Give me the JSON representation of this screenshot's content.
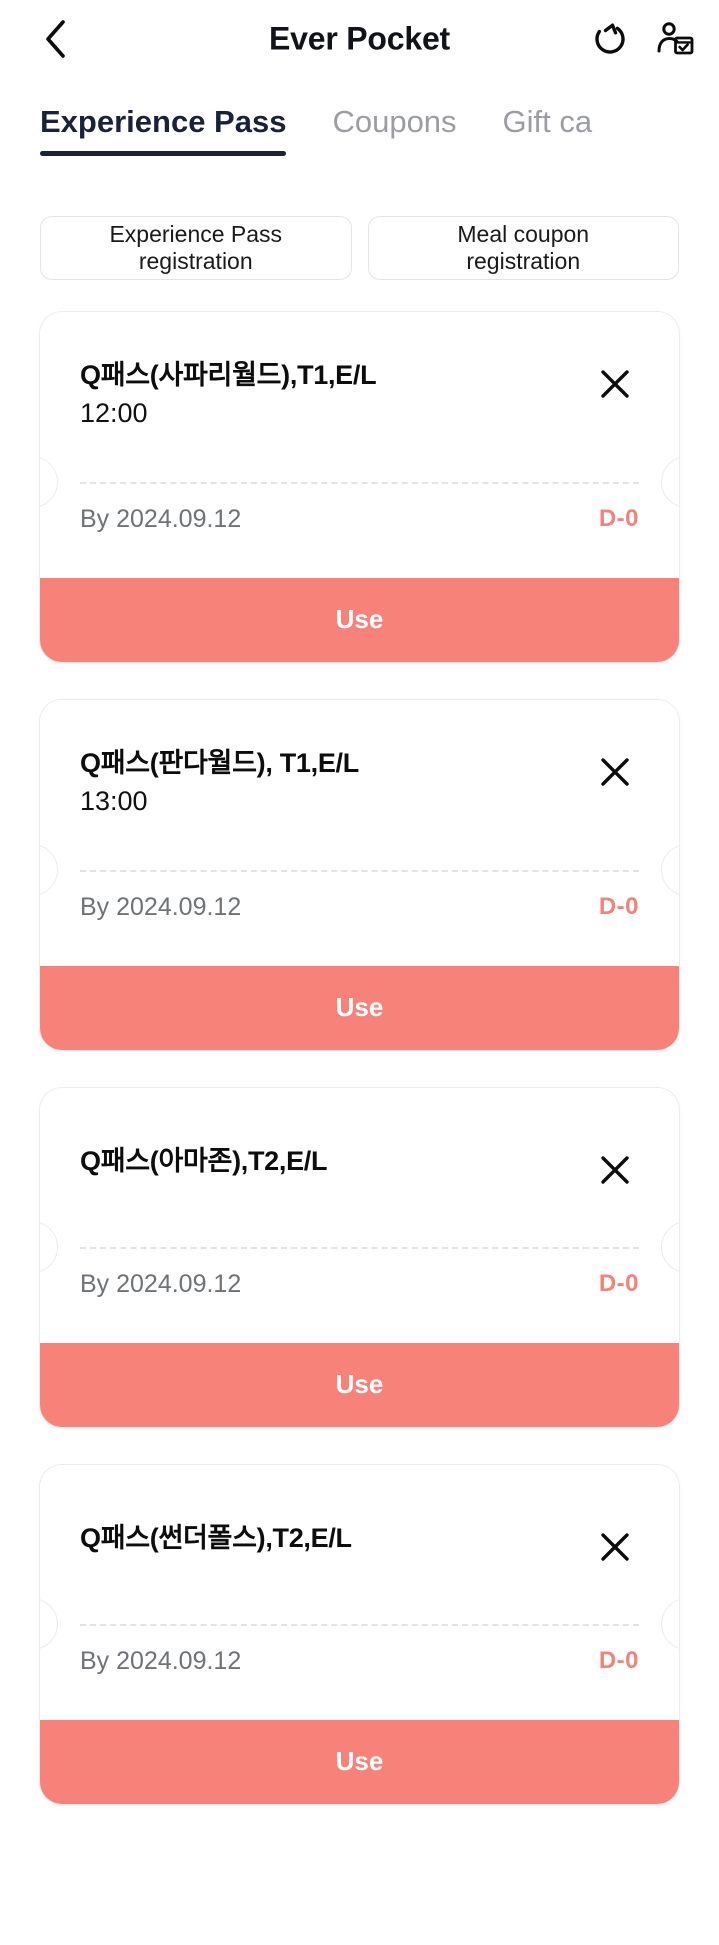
{
  "header": {
    "title": "Ever Pocket",
    "back_icon": "chevron-left-icon",
    "refresh_icon": "refresh-icon",
    "profile_icon": "person-calendar-check-icon"
  },
  "tabs": [
    {
      "label": "Experience Pass",
      "active": true
    },
    {
      "label": "Coupons",
      "active": false
    },
    {
      "label": "Gift ca",
      "active": false
    }
  ],
  "registration": {
    "experience_pass_label": "Experience Pass\nregistration",
    "experience_pass_line1": "Experience Pass",
    "experience_pass_line2": "registration",
    "meal_coupon_line1": "Meal coupon",
    "meal_coupon_line2": "registration"
  },
  "colors": {
    "accent": "#f68279",
    "dday": "#f0847c",
    "tab_active": "#1b2238",
    "tab_inactive": "#9b9da3"
  },
  "tickets": [
    {
      "title": "Q패스(사파리월드),T1,E/L",
      "time": "12:00",
      "date": "By 2024.09.12",
      "dday": "D-0",
      "use_label": "Use",
      "close_icon": "close-icon"
    },
    {
      "title": "Q패스(판다월드), T1,E/L",
      "time": "13:00",
      "date": "By 2024.09.12",
      "dday": "D-0",
      "use_label": "Use",
      "close_icon": "close-icon"
    },
    {
      "title": "Q패스(아마존),T2,E/L",
      "time": "",
      "date": "By 2024.09.12",
      "dday": "D-0",
      "use_label": "Use",
      "close_icon": "close-icon"
    },
    {
      "title": "Q패스(썬더폴스),T2,E/L",
      "time": "",
      "date": "By 2024.09.12",
      "dday": "D-0",
      "use_label": "Use",
      "close_icon": "close-icon"
    }
  ]
}
